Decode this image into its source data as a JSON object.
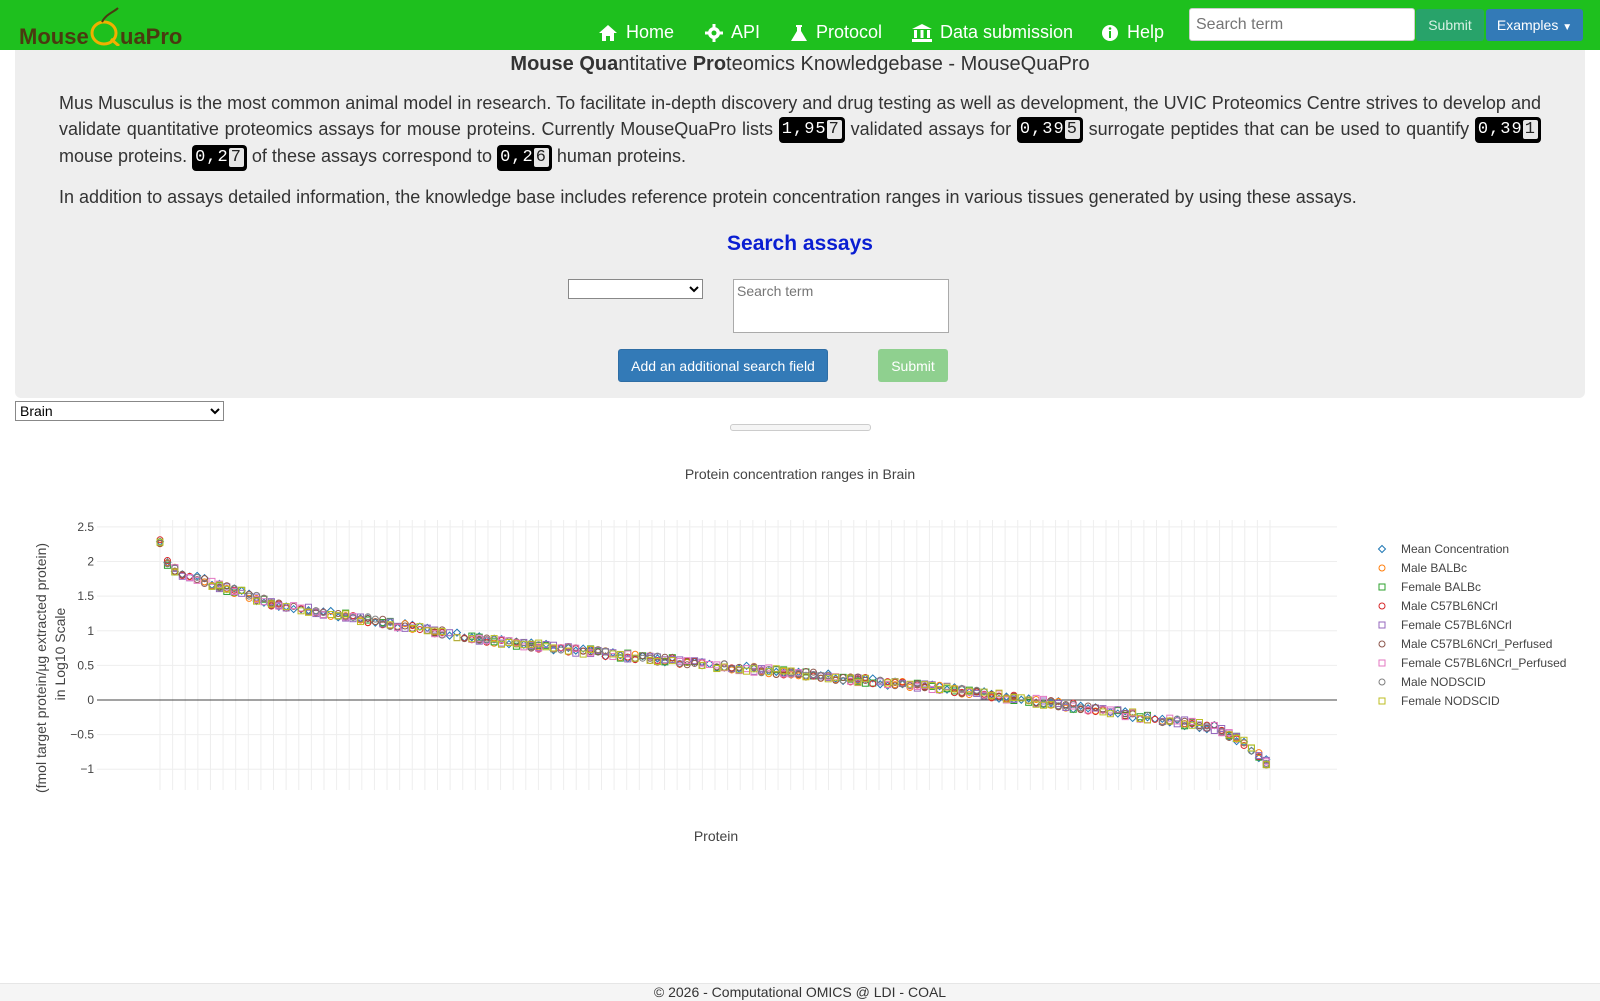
{
  "nav": {
    "brand": "MouseQuaPro",
    "items": [
      {
        "label": "Home",
        "icon": "home-icon"
      },
      {
        "label": "API",
        "icon": "gear-icon"
      },
      {
        "label": "Protocol",
        "icon": "flask-icon"
      },
      {
        "label": "Data submission",
        "icon": "bank-icon"
      },
      {
        "label": "Help",
        "icon": "info-icon"
      }
    ],
    "search_placeholder": "Search term",
    "submit_label": "Submit",
    "examples_label": "Examples"
  },
  "hero": {
    "title_bold1": "Mouse Qua",
    "title_mid": "ntitative ",
    "title_bold2": "Pro",
    "title_rest": "teomics Knowledgebase - MouseQuaPro",
    "p1_a": "Mus Musculus is the most common animal model in research. To facilitate in-depth discovery and drug testing as well as development, the UVIC Proteomics Centre strives to develop and validate quantitative proteomics assays for mouse proteins. Currently MouseQuaPro lists",
    "p1_b": "validated assays for",
    "p1_c": "surrogate peptides that can be used to quantify",
    "p1_d": "mouse proteins.",
    "p1_e": "of these assays correspond to",
    "p1_f": "human proteins.",
    "count_assays": "1,95",
    "count_assays_last": "7",
    "count_peptides": "0,39",
    "count_peptides_last": "5",
    "count_mouse": "0,39",
    "count_mouse_last": "1",
    "count_assays_human": "0,2",
    "count_assays_human_last": "7",
    "count_human": "0,2",
    "count_human_last": "6",
    "p2": "In addition to assays detailed information, the knowledge base includes reference protein concentration ranges in various tissues generated by using these assays."
  },
  "search": {
    "heading": "Search assays",
    "term_placeholder": "Search term",
    "add_label": "Add an additional search field",
    "submit_label": "Submit"
  },
  "tissue_select": "Brain",
  "chart_data": {
    "type": "scatter",
    "title": "Protein concentration ranges in Brain",
    "xlabel": "Protein",
    "ylabel_line1": "(fmol target protein/µg extracted protein)",
    "ylabel_line2": "in Log10 Scale",
    "ylim": [
      -1.3,
      2.6
    ],
    "yticks": [
      "2.5",
      "2",
      "1.5",
      "1",
      "0.5",
      "0",
      "−0.5",
      "−1"
    ],
    "ytick_values": [
      2.5,
      2,
      1.5,
      1,
      0.5,
      0,
      -0.5,
      -1
    ],
    "grid": true,
    "legend_position": "right",
    "n_proteins": 300,
    "curve": {
      "x": [
        0,
        0.005,
        0.015,
        0.04,
        0.1,
        0.3,
        0.5,
        0.7,
        0.85,
        0.95,
        0.98,
        1.0
      ],
      "y": [
        2.28,
        2.0,
        1.85,
        1.72,
        1.4,
        0.85,
        0.5,
        0.18,
        -0.15,
        -0.4,
        -0.65,
        -0.95
      ]
    },
    "series": [
      {
        "name": "Mean Concentration",
        "color": "#1f77b4",
        "marker": "diamond"
      },
      {
        "name": "Male BALBc",
        "color": "#ff7f0e",
        "marker": "circle"
      },
      {
        "name": "Female BALBc",
        "color": "#2ca02c",
        "marker": "square"
      },
      {
        "name": "Male C57BL6NCrl",
        "color": "#d62728",
        "marker": "circle"
      },
      {
        "name": "Female C57BL6NCrl",
        "color": "#9467bd",
        "marker": "square"
      },
      {
        "name": "Male C57BL6NCrl_Perfused",
        "color": "#8c564b",
        "marker": "circle"
      },
      {
        "name": "Female C57BL6NCrl_Perfused",
        "color": "#e377c2",
        "marker": "square"
      },
      {
        "name": "Male NODSCID",
        "color": "#7f7f7f",
        "marker": "circle"
      },
      {
        "name": "Female NODSCID",
        "color": "#bcbd22",
        "marker": "square"
      }
    ]
  },
  "footer": "© 2026 - Computational OMICS @ LDI - COAL"
}
